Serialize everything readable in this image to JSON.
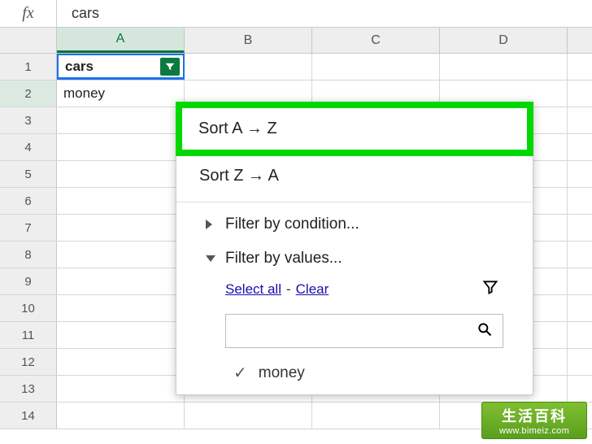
{
  "formula_bar": {
    "fx_label": "fx",
    "value": "cars"
  },
  "columns": [
    "A",
    "B",
    "C",
    "D"
  ],
  "active_column_index": 0,
  "rows": [
    1,
    2,
    3,
    4,
    5,
    6,
    7,
    8,
    9,
    10,
    11,
    12,
    13,
    14
  ],
  "cells": {
    "A1": "cars",
    "A2": "money"
  },
  "active_row_index": 1,
  "dropdown": {
    "sort_az": "Sort A → Z",
    "sort_za": "Sort Z → A",
    "filter_condition": "Filter by condition...",
    "filter_values": "Filter by values...",
    "select_all": "Select all",
    "clear": "Clear",
    "dash": "-",
    "search_placeholder": "",
    "value_items": [
      "money"
    ]
  },
  "watermark": {
    "cn": "生活百科",
    "url": "www.bimeiz.com"
  }
}
